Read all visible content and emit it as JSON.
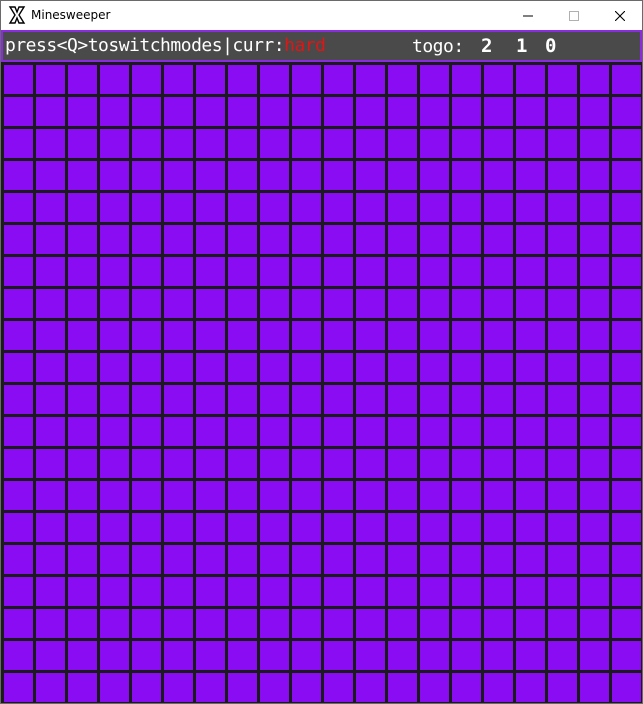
{
  "window": {
    "title": "Minesweeper"
  },
  "status": {
    "prefix": "press<Q>toswitchmodes|curr:",
    "mode": "hard",
    "togo_label": "togo:",
    "mines_remaining_digits": [
      "2",
      "1",
      "0"
    ]
  },
  "board": {
    "rows": 20,
    "cols": 20,
    "cell_color": "#8a0cf2",
    "state": "all-covered"
  },
  "colors": {
    "status_bg": "#4a4a4a",
    "status_border": "#8a2be2",
    "mode_text": "#e01515",
    "board_gap": "#1b1b1b"
  }
}
